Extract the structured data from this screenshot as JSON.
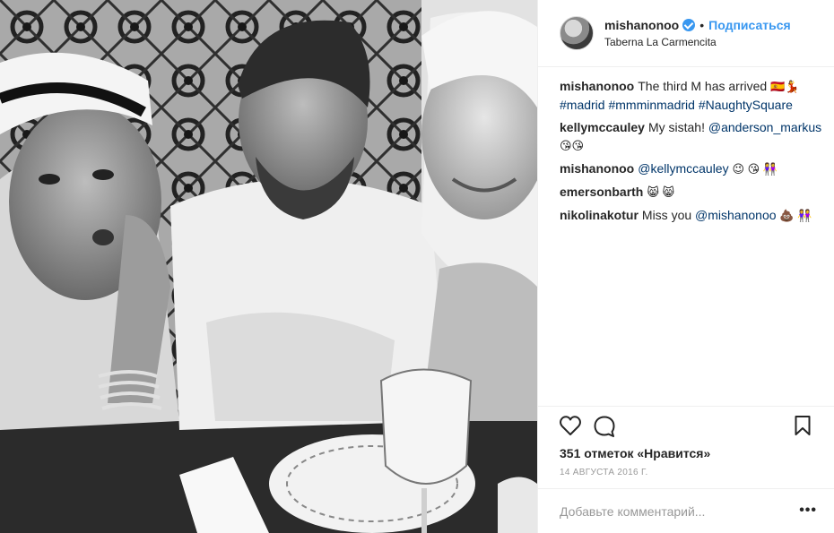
{
  "header": {
    "username": "mishanonoo",
    "dot": "•",
    "follow_label": "Подписаться",
    "location": "Taberna La Carmencita"
  },
  "comments": [
    {
      "user": "mishanonoo",
      "text": "The third M has arrived ",
      "emoji": "🇪🇸💃",
      "hashtags": "#madrid #mmminmadrid #NaughtySquare"
    },
    {
      "user": "kellymccauley",
      "text": "My sistah! ",
      "mention": "@anderson_markus",
      "emoji": "😘😘"
    },
    {
      "user": "mishanonoo",
      "mention": "@kellymccauley",
      "emoji": "😉 😘 👭"
    },
    {
      "user": "emersonbarth",
      "emoji": "😸 😸"
    },
    {
      "user": "nikolinakotur",
      "text": "Miss you ",
      "mention": "@mishanonoo",
      "emoji": "💩 👭"
    }
  ],
  "actions": {
    "like_icon": "heart-icon",
    "comment_icon": "speech-bubble-icon",
    "save_icon": "bookmark-icon"
  },
  "likes_text": "351 отметок «Нравится»",
  "date_text": "14 АВГУСТА 2016 Г.",
  "add_comment": {
    "placeholder": "Добавьте комментарий...",
    "more_label": "•••"
  },
  "colors": {
    "link_blue": "#3897f0",
    "tag_blue": "#003569",
    "border": "#efefef",
    "muted": "#999999"
  }
}
